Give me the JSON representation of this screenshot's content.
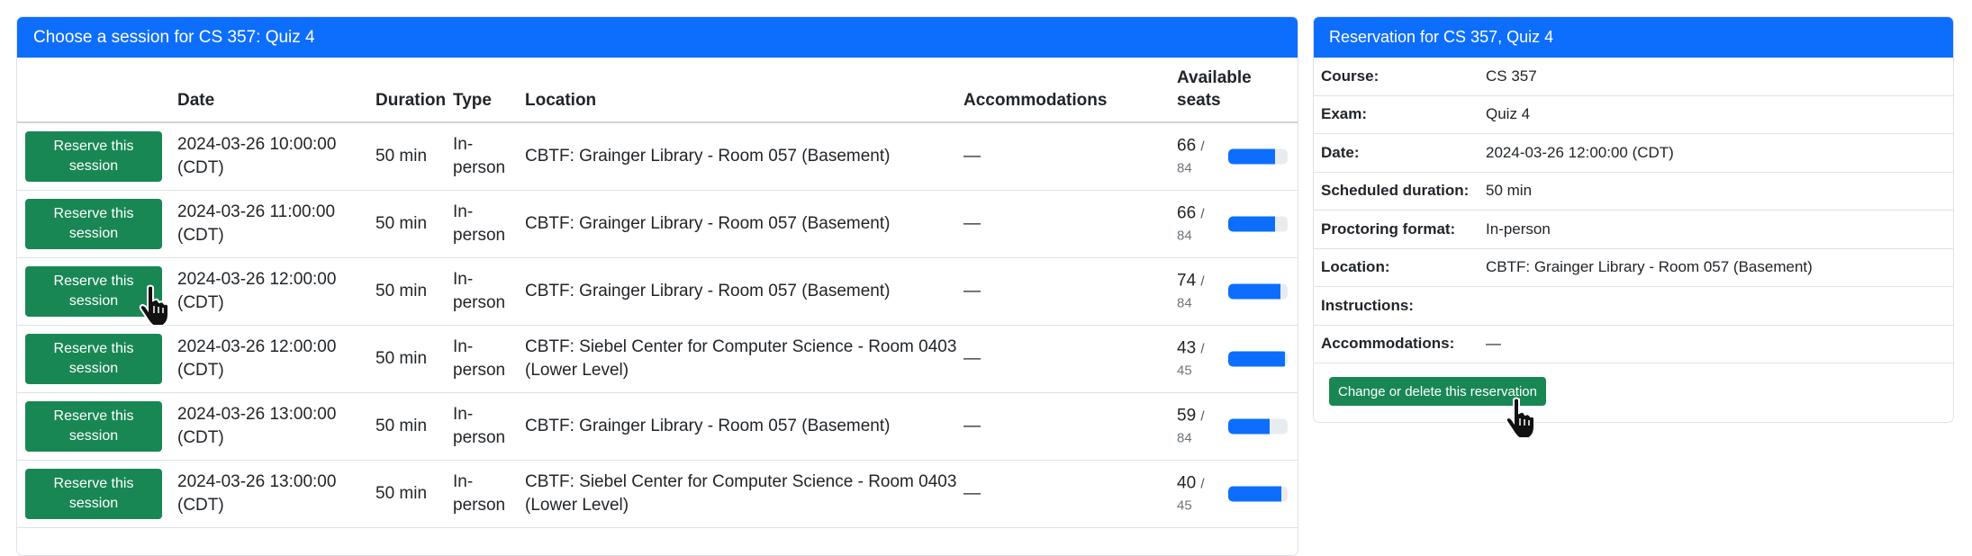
{
  "sessions_card": {
    "title": "Choose a session for CS 357: Quiz 4",
    "headers": {
      "date": "Date",
      "duration": "Duration",
      "type": "Type",
      "location": "Location",
      "accommodations": "Accommodations",
      "seats_line1": "Available",
      "seats_line2": "seats"
    },
    "reserve_label": "Reserve this session",
    "rows": [
      {
        "date": "2024-03-26 10:00:00",
        "tz": "(CDT)",
        "duration": "50 min",
        "type1": "In-",
        "type2": "person",
        "location1": "CBTF: Grainger Library - Room 057 (Basement)",
        "location2": "",
        "accommodations": "—",
        "seats": "66",
        "total": "84",
        "fill": 0.786
      },
      {
        "date": "2024-03-26 11:00:00",
        "tz": "(CDT)",
        "duration": "50 min",
        "type1": "In-",
        "type2": "person",
        "location1": "CBTF: Grainger Library - Room 057 (Basement)",
        "location2": "",
        "accommodations": "—",
        "seats": "66",
        "total": "84",
        "fill": 0.786
      },
      {
        "date": "2024-03-26 12:00:00",
        "tz": "(CDT)",
        "duration": "50 min",
        "type1": "In-",
        "type2": "person",
        "location1": "CBTF: Grainger Library - Room 057 (Basement)",
        "location2": "",
        "accommodations": "—",
        "seats": "74",
        "total": "84",
        "fill": 0.881
      },
      {
        "date": "2024-03-26 12:00:00",
        "tz": "(CDT)",
        "duration": "50 min",
        "type1": "In-",
        "type2": "person",
        "location1": "CBTF: Siebel Center for Computer Science - Room 0403",
        "location2": "(Lower Level)",
        "accommodations": "—",
        "seats": "43",
        "total": "45",
        "fill": 0.956
      },
      {
        "date": "2024-03-26 13:00:00",
        "tz": "(CDT)",
        "duration": "50 min",
        "type1": "In-",
        "type2": "person",
        "location1": "CBTF: Grainger Library - Room 057 (Basement)",
        "location2": "",
        "accommodations": "—",
        "seats": "59",
        "total": "84",
        "fill": 0.702
      },
      {
        "date": "2024-03-26 13:00:00",
        "tz": "(CDT)",
        "duration": "50 min",
        "type1": "In-",
        "type2": "person",
        "location1": "CBTF: Siebel Center for Computer Science - Room 0403",
        "location2": "(Lower Level)",
        "accommodations": "—",
        "seats": "40",
        "total": "45",
        "fill": 0.889
      }
    ]
  },
  "reservation_card": {
    "title": "Reservation for CS 357, Quiz 4",
    "fields": [
      {
        "label": "Course:",
        "value": "CS 357"
      },
      {
        "label": "Exam:",
        "value": "Quiz 4"
      },
      {
        "label": "Date:",
        "value": "2024-03-26 12:00:00 (CDT)"
      },
      {
        "label": "Scheduled duration:",
        "value": "50 min"
      },
      {
        "label": "Proctoring format:",
        "value": "In-person"
      },
      {
        "label": "Location:",
        "value": "CBTF: Grainger Library - Room 057 (Basement)"
      },
      {
        "label": "Instructions:",
        "value": ""
      },
      {
        "label": "Accommodations:",
        "value": "—"
      }
    ],
    "change_button": "Change or delete this reservation"
  },
  "colors": {
    "header_bg": "#0d6efd",
    "button_green": "#198754",
    "progress_blue": "#0d6efd"
  },
  "icons": {
    "cursor": "hand-pointer-icon"
  }
}
